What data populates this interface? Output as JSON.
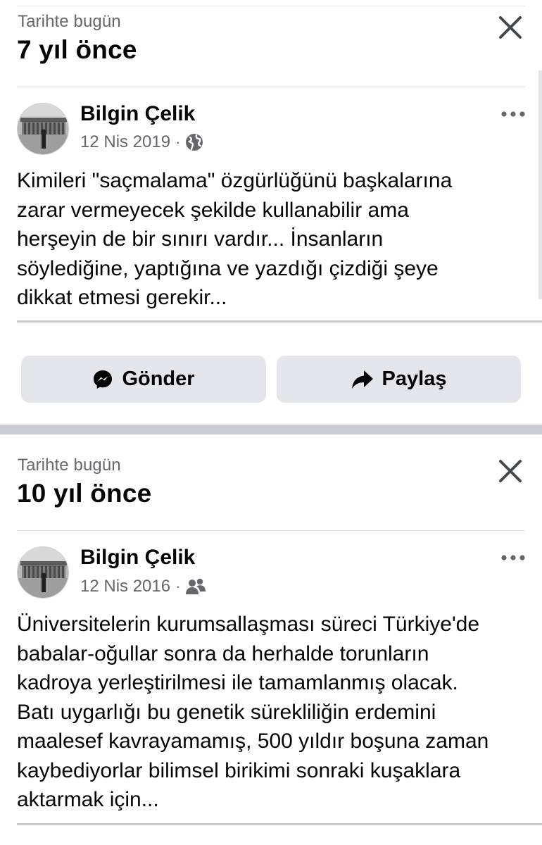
{
  "memories": [
    {
      "kicker": "Tarihte bugün",
      "years_ago": "7 yıl önce",
      "post": {
        "author": "Bilgin Çelik",
        "date": "12 Nis 2019",
        "separator": "·",
        "privacy_icon": "globe-icon",
        "text": "Kimileri \"saçmalama\" özgürlüğünü başkalarına\nzarar vermeyecek şekilde kullanabilir ama\nherşeyin de bir sınırı vardır... İnsanların\nsöylediğine, yaptığına ve yazdığı çizdiği şeye\ndikkat etmesi gerekir..."
      },
      "actions": {
        "send_label": "Gönder",
        "send_icon": "messenger-icon",
        "share_label": "Paylaş",
        "share_icon": "share-arrow-icon"
      }
    },
    {
      "kicker": "Tarihte bugün",
      "years_ago": "10 yıl önce",
      "post": {
        "author": "Bilgin Çelik",
        "date": "12 Nis 2016",
        "separator": "·",
        "privacy_icon": "friends-icon",
        "text": "Üniversitelerin kurumsallaşması süreci Türkiye'de\nbabalar-oğullar sonra da herhalde torunların\nkadroya yerleştirilmesi ile tamamlanmış olacak.\nBatı uygarlığı bu genetik sürekliliğin erdemini\nmaalesef kavrayamamış, 500 yıldır boşuna zaman\nkaybediyorlar bilimsel birikimi sonraki kuşaklara\naktarmak için..."
      }
    }
  ],
  "colors": {
    "primary_text": "#050505",
    "secondary_text": "#65676b",
    "button_bg": "#e4e6eb",
    "divider": "#c9ccd1"
  }
}
